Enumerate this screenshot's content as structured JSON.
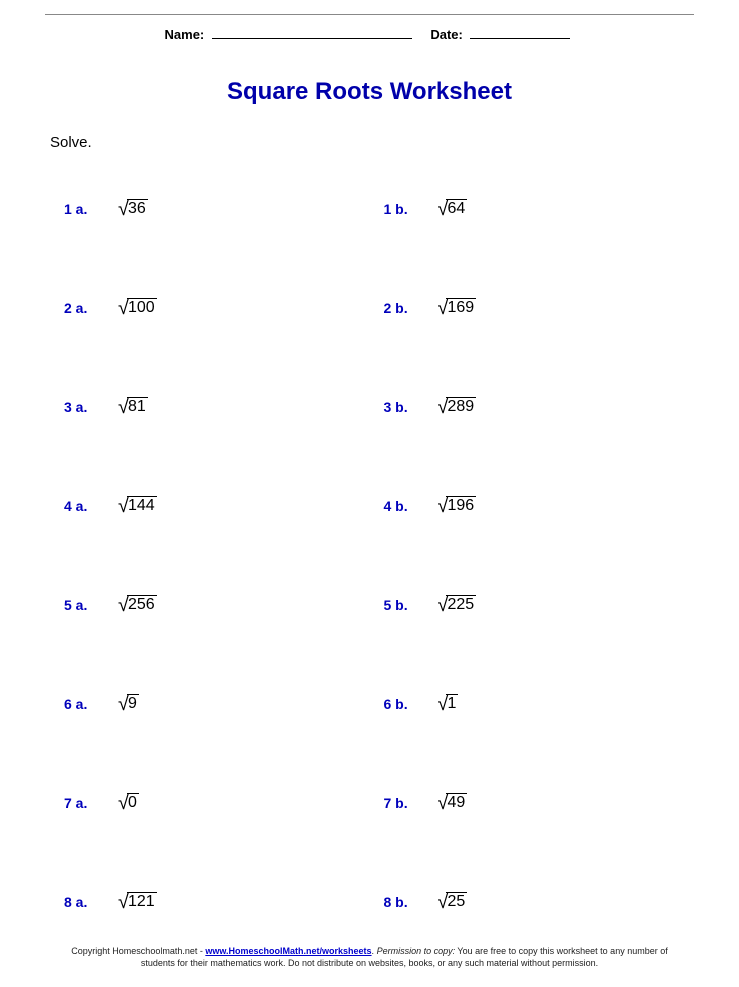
{
  "header": {
    "name_label": "Name:",
    "date_label": "Date:"
  },
  "title": "Square Roots Worksheet",
  "instruction": "Solve.",
  "problems": [
    {
      "a_label": "1 a.",
      "a_value": "36",
      "b_label": "1 b.",
      "b_value": "64"
    },
    {
      "a_label": "2 a.",
      "a_value": "100",
      "b_label": "2 b.",
      "b_value": "169"
    },
    {
      "a_label": "3 a.",
      "a_value": "81",
      "b_label": "3 b.",
      "b_value": "289"
    },
    {
      "a_label": "4 a.",
      "a_value": "144",
      "b_label": "4 b.",
      "b_value": "196"
    },
    {
      "a_label": "5 a.",
      "a_value": "256",
      "b_label": "5 b.",
      "b_value": "225"
    },
    {
      "a_label": "6 a.",
      "a_value": "9",
      "b_label": "6 b.",
      "b_value": "1"
    },
    {
      "a_label": "7 a.",
      "a_value": "0",
      "b_label": "7 b.",
      "b_value": "49"
    },
    {
      "a_label": "8 a.",
      "a_value": "121",
      "b_label": "8 b.",
      "b_value": "25"
    }
  ],
  "footer": {
    "pretext": "Copyright Homeschoolmath.net - ",
    "link": "www.HomeschoolMath.net/worksheets",
    "period": ". ",
    "permission_label": "Permission to copy:",
    "permission_text": " You are free to copy this worksheet to any number of students for their mathematics work. Do not distribute on websites, books, or any such material without permission."
  }
}
